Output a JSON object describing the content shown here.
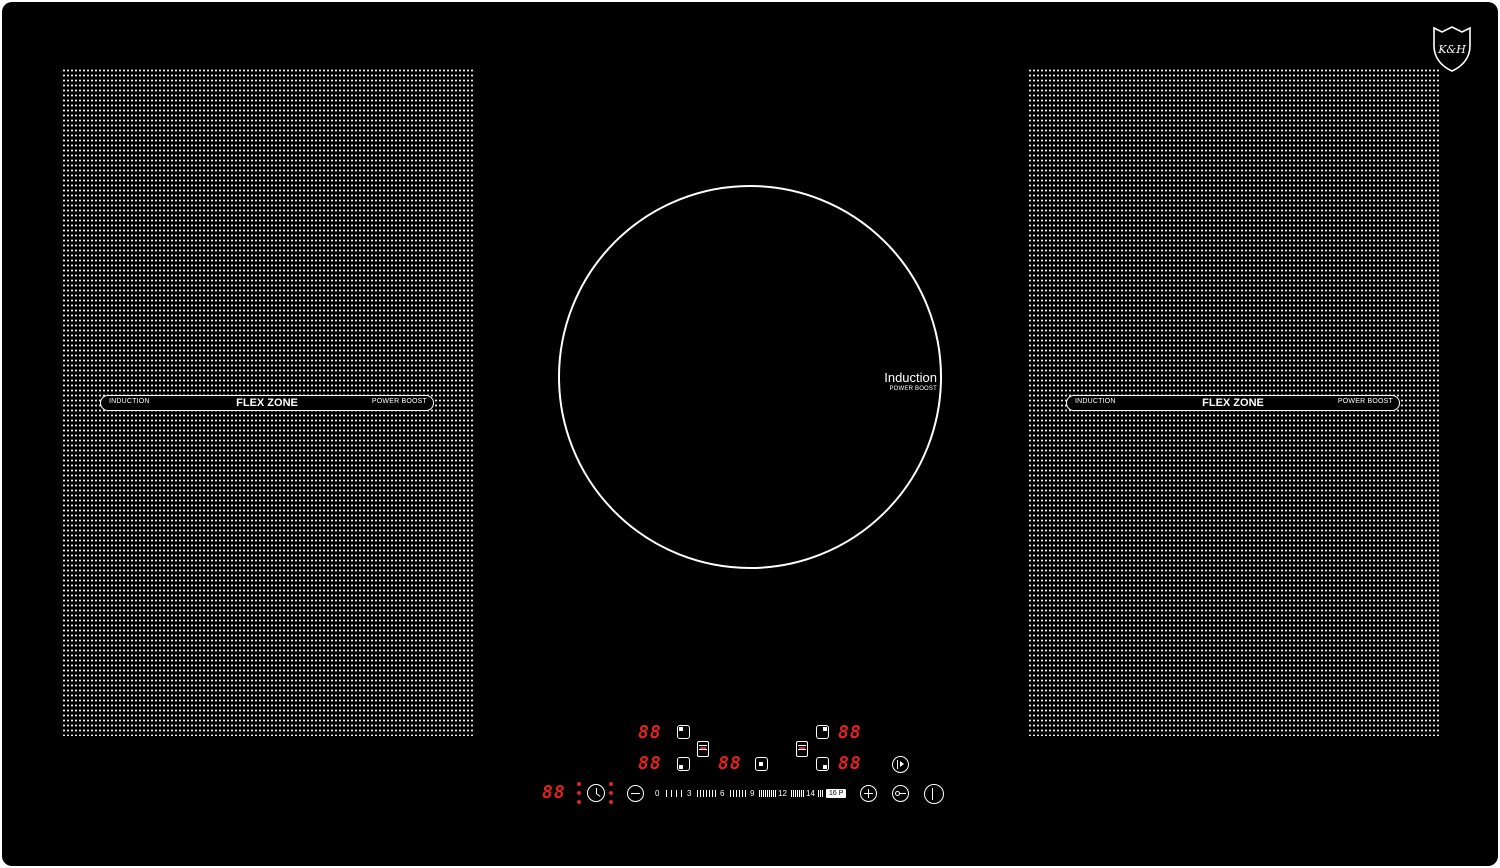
{
  "cooktop": {
    "colors": {
      "glass": "#000000",
      "print": "#ffffff",
      "display": "#e32222"
    },
    "logo": {
      "text": "K&H",
      "icon": "shield-logo-icon"
    },
    "left_zone": {
      "left_label": "INDUCTION",
      "center_label": "FLEX ZONE",
      "right_label": "POWER BOOST"
    },
    "right_zone": {
      "left_label": "INDUCTION",
      "center_label": "FLEX ZONE",
      "right_label": "POWER BOOST"
    },
    "center_zone": {
      "title": "Induction",
      "subtitle": "POWER BOOST"
    }
  },
  "controls": {
    "displays": {
      "left_top": "88",
      "left_bottom": "88",
      "center": "88",
      "right_top": "88",
      "right_bottom": "88",
      "timer": "88"
    },
    "slider": {
      "numbers": [
        "0",
        "3",
        "6",
        "9",
        "12",
        "14"
      ],
      "max_label": "16 P"
    },
    "icons": {
      "timer": "timer-icon",
      "minus": "minus-icon",
      "plus": "plus-icon",
      "lock": "key-lock-icon",
      "power": "power-icon",
      "pause": "pause-icon"
    }
  }
}
